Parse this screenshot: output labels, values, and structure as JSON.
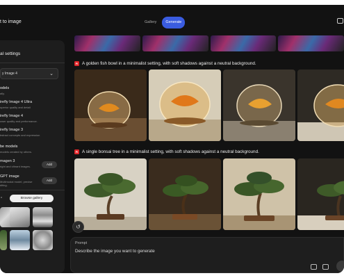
{
  "app": {
    "title": "t to image",
    "tabs": [
      {
        "label": "Gallery",
        "active": false
      },
      {
        "label": "Generate",
        "active": true
      }
    ],
    "accent": "#3a5ce0"
  },
  "settings": {
    "title": "al settings",
    "model_select_value": "y Image 4",
    "models_heading": "odels",
    "models_sub": "ally.",
    "options": [
      {
        "title": "irefly Image 4 Ultra",
        "desc": "uperior quality and detail"
      },
      {
        "title": "irefly Image 4",
        "desc": "ower quality and performance."
      },
      {
        "title": "irefly Image 3",
        "desc": "bstract concepts and expression"
      }
    ],
    "partner_heading": "be models",
    "partner_sub": "models created by others.",
    "partner_options": [
      {
        "title": "magen 3",
        "desc": "right and vibrant images.",
        "button": "Add"
      },
      {
        "title": "GPT image",
        "desc": "Multimodal model, precise\nditing.",
        "button": "Add"
      }
    ],
    "browse_label": "Browse gallery"
  },
  "main": {
    "prompts": [
      {
        "badge": "Fi",
        "text": "A golden fish bowl in a minimalist setting, with soft shadows against a neutral background."
      },
      {
        "badge": "Fi",
        "text": "A single bonsai tree in a minimalist setting, with soft shadows against a neutral background."
      }
    ],
    "prompt_box": {
      "label": "Prompt",
      "placeholder": "Describe the image you want to generate"
    }
  }
}
